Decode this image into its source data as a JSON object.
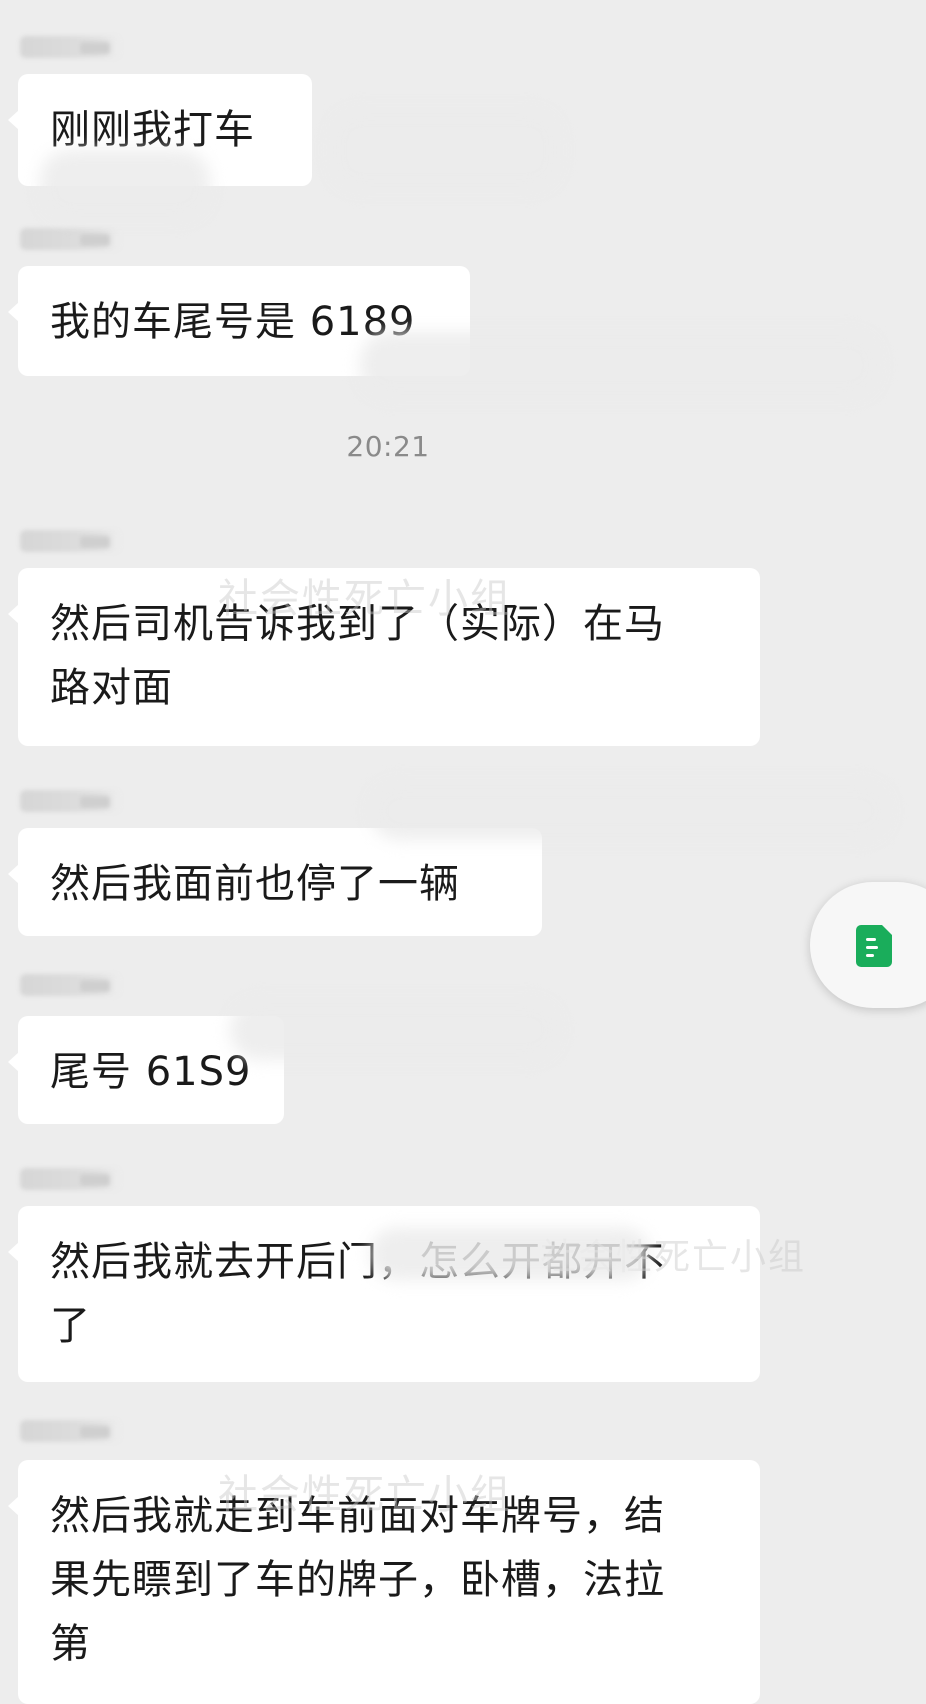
{
  "chat": {
    "time_divider": "20:21",
    "messages": [
      {
        "text": "刚刚我打车"
      },
      {
        "text": "我的车尾号是 6189"
      },
      {
        "text": "然后司机告诉我到了（实际）在马\n路对面"
      },
      {
        "text": "然后我面前也停了一辆"
      },
      {
        "text": "尾号 61S9"
      },
      {
        "text": "然后我就去开后门，怎么开都开不\n了"
      },
      {
        "text": "然后我就走到车前面对车牌号，结\n果先瞟到了车的牌子，卧槽，法拉\n第"
      }
    ],
    "watermarks": [
      "社会性死亡小组",
      "社会性死亡小组",
      "社会性死亡小组"
    ]
  },
  "floating_button": {
    "icon": "document-icon",
    "color": "#1aad5b"
  }
}
